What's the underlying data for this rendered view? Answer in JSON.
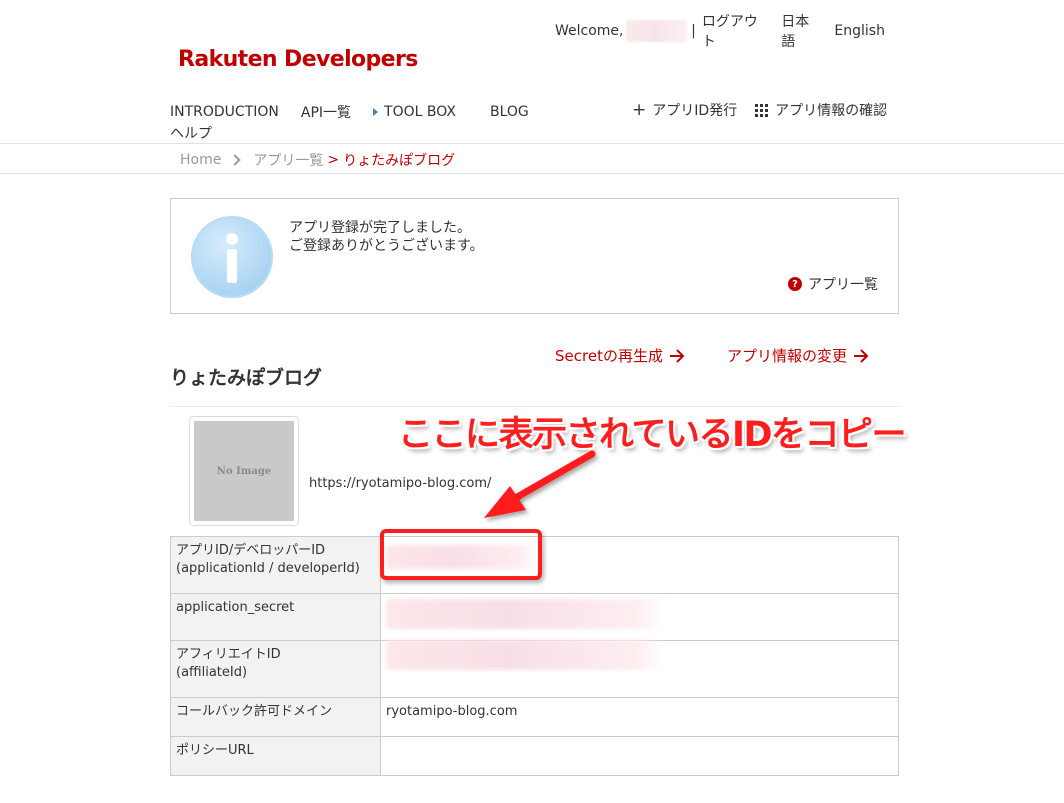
{
  "header": {
    "welcome": "Welcome,",
    "separator": "|",
    "logout": "ログアウト",
    "lang_ja": "日本語",
    "lang_en": "English",
    "logo": "Rakuten Developers"
  },
  "nav": {
    "items": [
      "INTRODUCTION",
      "API一覧",
      "TOOL BOX",
      "BLOG",
      "ヘルプ"
    ],
    "issue_app_id": "アプリID発行",
    "app_info": "アプリ情報の確認"
  },
  "breadcrumb": {
    "home": "Home",
    "app_list": "アプリ一覧",
    "gt": ">",
    "current": "りょたみぽブログ"
  },
  "notice": {
    "line1": "アプリ登録が完了しました。",
    "line2": "ご登録ありがとうございます。",
    "link": "アプリ一覧",
    "link_icon": "question-circle-icon"
  },
  "actions": {
    "regenerate_secret": "Secretの再生成",
    "change_app_info": "アプリ情報の変更"
  },
  "app": {
    "title": "りょたみぽブログ",
    "thumb_text": "No Image",
    "url": "https://ryotamipo-blog.com/"
  },
  "table": {
    "rows": [
      {
        "label1": "アプリID/デベロッパーID",
        "label2": "(applicationId / developerId)",
        "value": ""
      },
      {
        "label1": "application_secret",
        "label2": "",
        "value": ""
      },
      {
        "label1": "アフィリエイトID",
        "label2": "(affiliateId)",
        "value": ""
      },
      {
        "label1": "コールバック許可ドメイン",
        "label2": "",
        "value": "ryotamipo-blog.com"
      },
      {
        "label1": "ポリシーURL",
        "label2": "",
        "value": ""
      }
    ]
  },
  "annotation": {
    "text": "ここに表示されているIDをコピー"
  },
  "colors": {
    "brand": "#bf0000",
    "annotation": "#ff1e1e",
    "info_blue": "#a9d3f2"
  }
}
